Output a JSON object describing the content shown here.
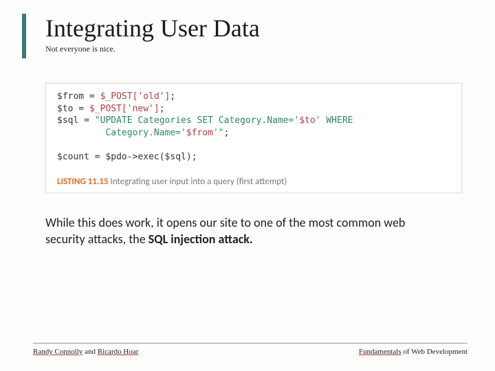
{
  "header": {
    "title": "Integrating User Data",
    "subtitle": "Not everyone is nice."
  },
  "code": {
    "line1a": "$from",
    "line1b": " = ",
    "line1c": "$_POST['old']",
    "line1d": ";",
    "line2a": "$to",
    "line2b": " = ",
    "line2c": "$_POST['new']",
    "line2d": ";",
    "line3a": "$sql",
    "line3b": " = ",
    "line3c": "\"UPDATE Categories SET Category.Name='",
    "line3d": "$to",
    "line3e": "' WHERE",
    "line4a": "         Category.Name='",
    "line4b": "$from",
    "line4c": "'\"",
    "line4d": ";",
    "blank": "",
    "line5a": "$count",
    "line5b": " = ",
    "line5c": "$pdo->exec($sql)",
    "line5d": ";"
  },
  "listing": {
    "label": "LISTING 11.15",
    "caption": " Integrating user input into a query (first attempt)"
  },
  "body": {
    "pre": "While this does work, it opens our site to one of the most common web security attacks, the ",
    "bold": "SQL injection attack."
  },
  "footer": {
    "left_a": "Randy Connolly",
    "left_mid": " and ",
    "left_b": "Ricardo Hoar",
    "right_a": "Fundamentals",
    "right_b": " of Web Development"
  }
}
